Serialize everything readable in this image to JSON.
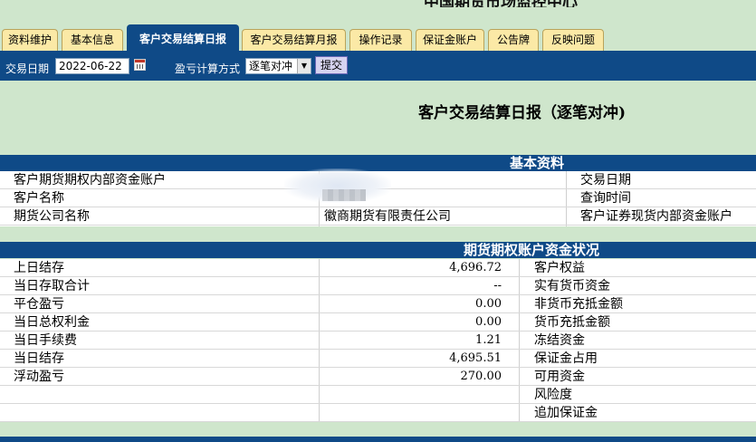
{
  "page": {
    "top_title": "中国期货市场监控中心"
  },
  "tabs": [
    {
      "label": "资料维护"
    },
    {
      "label": "基本信息"
    },
    {
      "label": "客户交易结算日报",
      "active": true
    },
    {
      "label": "客户交易结算月报"
    },
    {
      "label": "操作记录"
    },
    {
      "label": "保证金账户"
    },
    {
      "label": "公告牌"
    },
    {
      "label": "反映问题"
    }
  ],
  "toolbar": {
    "date_label": "交易日期",
    "date_value": "2022-06-22",
    "calc_label": "盈亏计算方式",
    "calc_value": "逐笔对冲",
    "submit_label": "提交"
  },
  "report": {
    "title": "客户交易结算日报（逐笔对冲)"
  },
  "basic": {
    "section_title": "基本资料",
    "rows": [
      {
        "left": "客户期货期权内部资金账户",
        "mid": "",
        "right": "交易日期"
      },
      {
        "left": "客户名称",
        "mid": "",
        "right": "查询时间"
      },
      {
        "left": "期货公司名称",
        "mid": "徽商期货有限责任公司",
        "right": "客户证券现货内部资金账户"
      }
    ]
  },
  "funds": {
    "section_title": "期货期权账户资金状况",
    "rows": [
      {
        "label": "上日结存",
        "value": "4,696.72",
        "right": "客户权益"
      },
      {
        "label": "当日存取合计",
        "value": "--",
        "right": "实有货币资金"
      },
      {
        "label": "平仓盈亏",
        "value": "0.00",
        "right": "非货币充抵金额"
      },
      {
        "label": "当日总权利金",
        "value": "0.00",
        "right": "货币充抵金额"
      },
      {
        "label": "当日手续费",
        "value": "1.21",
        "right": "冻结资金"
      },
      {
        "label": "当日结存",
        "value": "4,695.51",
        "right": "保证金占用"
      },
      {
        "label": "浮动盈亏",
        "value": "270.00",
        "right": "可用资金"
      },
      {
        "label": "",
        "value": "",
        "right": "风险度"
      },
      {
        "label": "",
        "value": "",
        "right": "追加保证金"
      }
    ]
  },
  "colors": {
    "header_blue": "#0f4a87",
    "page_bg": "#cfe6cc",
    "tab_bg": "#fbe9a6",
    "submit_bg": "#d6d3f0"
  }
}
